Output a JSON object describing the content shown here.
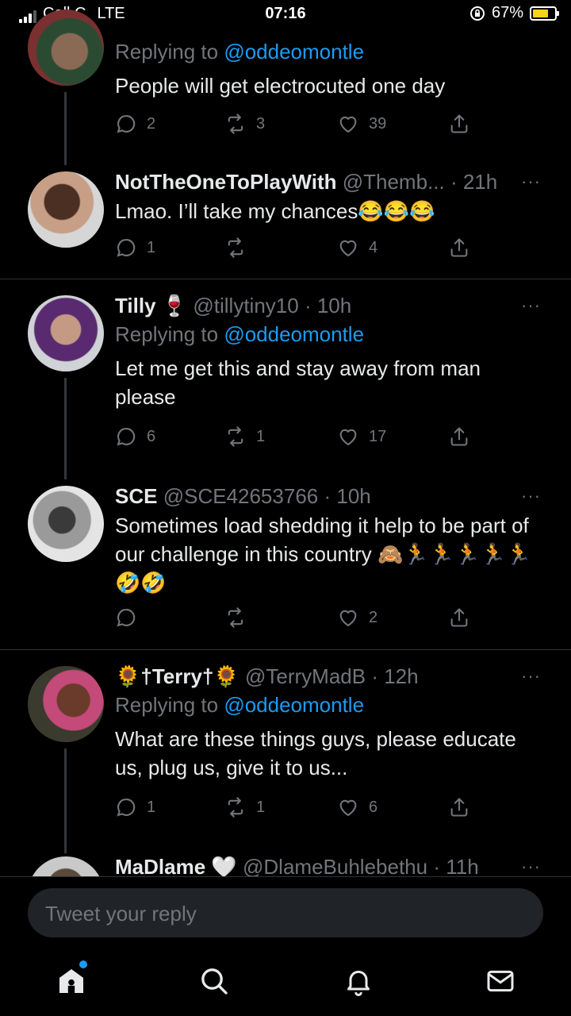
{
  "status_bar": {
    "carrier": "Cell C",
    "network": "LTE",
    "time": "07:16",
    "battery_percent": "67%"
  },
  "tweets": [
    {
      "name": "",
      "handle": "",
      "time": "",
      "replying_prefix": "Replying to",
      "replying_to": "@oddeomontle",
      "text": "People will get electrocuted one day",
      "replies": "2",
      "retweets": "3",
      "likes": "39"
    },
    {
      "name": "NotTheOneToPlayWith",
      "handle": "@Themb...",
      "time": "· 21h",
      "text": "Lmao. I’ll take my chances😂😂😂",
      "replies": "1",
      "retweets": "",
      "likes": "4"
    },
    {
      "name": "Tilly 🍷",
      "handle": "@tillytiny10",
      "time": "· 10h",
      "replying_prefix": "Replying to",
      "replying_to": "@oddeomontle",
      "text": "Let me get this and stay away from man please",
      "replies": "6",
      "retweets": "1",
      "likes": "17"
    },
    {
      "name": "SCE",
      "handle": "@SCE42653766",
      "time": "· 10h",
      "text": "Sometimes load shedding it help to be part of our challenge in this country 🙈🏃🏃🏃🏃🏃🤣🤣",
      "replies": "",
      "retweets": "",
      "likes": "2"
    },
    {
      "name": "🌻†Terry†🌻",
      "handle": "@TerryMadB",
      "time": "· 12h",
      "replying_prefix": "Replying to",
      "replying_to": "@oddeomontle",
      "text": "What are these things guys, please educate us, plug us, give it to us...",
      "replies": "1",
      "retweets": "1",
      "likes": "6"
    },
    {
      "name": "MaDlame 🤍",
      "handle": "@DlameBuhlebethu",
      "time": "· 11h"
    }
  ],
  "more_icon": "···",
  "reply": {
    "placeholder": "Tweet your reply"
  },
  "tabs": [
    "home-icon",
    "search-icon",
    "notifications-icon",
    "messages-icon"
  ],
  "colors": {
    "accent": "#1d9bf0",
    "muted": "#71767b",
    "background": "#000000"
  }
}
